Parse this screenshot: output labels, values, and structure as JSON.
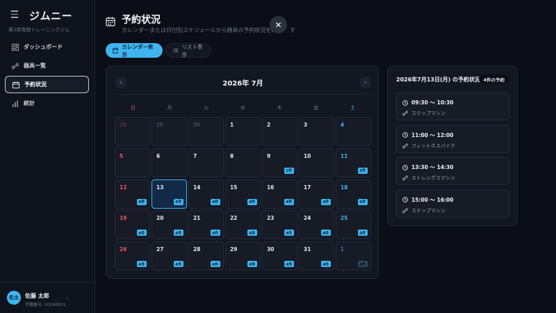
{
  "app": {
    "brand": "ジムニー",
    "subtitle": "第2体育館トレーニングジム"
  },
  "sidebar": {
    "items": [
      {
        "label": "ダッシュボード",
        "icon": "dashboard-icon",
        "active": false
      },
      {
        "label": "器具一覧",
        "icon": "equipment-icon",
        "active": false
      },
      {
        "label": "予約状況",
        "icon": "calendar-icon",
        "active": true
      },
      {
        "label": "統計",
        "icon": "chart-icon",
        "active": false
      }
    ]
  },
  "user": {
    "avatar": "佐太",
    "name": "佐藤 太郎",
    "id": "学籍番号: 20240001"
  },
  "header": {
    "title": "予約状況",
    "subtitle": "カレンダーまたは日付別スケジュールから器具の予約状況を確認 　す"
  },
  "view_toggle": {
    "calendar_label": "カレンダー表示",
    "list_label": "リスト表示"
  },
  "calendar": {
    "month_title": "2026年 7月",
    "weekdays": [
      "日",
      "月",
      "火",
      "水",
      "木",
      "金",
      "土"
    ],
    "weeks": [
      [
        {
          "day": "28",
          "other": true,
          "badge": ""
        },
        {
          "day": "29",
          "other": true,
          "badge": ""
        },
        {
          "day": "30",
          "other": true,
          "badge": ""
        },
        {
          "day": "1",
          "badge": ""
        },
        {
          "day": "2",
          "badge": ""
        },
        {
          "day": "3",
          "badge": ""
        },
        {
          "day": "4",
          "badge": ""
        }
      ],
      [
        {
          "day": "5",
          "badge": ""
        },
        {
          "day": "6",
          "badge": ""
        },
        {
          "day": "7",
          "badge": ""
        },
        {
          "day": "8",
          "badge": ""
        },
        {
          "day": "9",
          "badge": "1件"
        },
        {
          "day": "10",
          "badge": ""
        },
        {
          "day": "11",
          "badge": "3件"
        }
      ],
      [
        {
          "day": "12",
          "badge": "4件"
        },
        {
          "day": "13",
          "badge": "4件",
          "today": true
        },
        {
          "day": "14",
          "badge": "4件"
        },
        {
          "day": "15",
          "badge": "4件"
        },
        {
          "day": "16",
          "badge": "4件"
        },
        {
          "day": "17",
          "badge": "4件"
        },
        {
          "day": "18",
          "badge": "4件"
        }
      ],
      [
        {
          "day": "19",
          "badge": "4件"
        },
        {
          "day": "20",
          "badge": "4件"
        },
        {
          "day": "21",
          "badge": "4件"
        },
        {
          "day": "22",
          "badge": "4件"
        },
        {
          "day": "23",
          "badge": "4件"
        },
        {
          "day": "24",
          "badge": "4件"
        },
        {
          "day": "25",
          "badge": "4件"
        }
      ],
      [
        {
          "day": "26",
          "badge": "4件"
        },
        {
          "day": "27",
          "badge": "4件"
        },
        {
          "day": "28",
          "badge": "4件"
        },
        {
          "day": "29",
          "badge": "4件"
        },
        {
          "day": "30",
          "badge": "4件"
        },
        {
          "day": "31",
          "badge": "4件"
        },
        {
          "day": "1",
          "other": true,
          "badge": "4件"
        }
      ]
    ]
  },
  "reservations": {
    "title": "2026年7月13日(月) の予約状況",
    "count_badge": "4件の予約",
    "items": [
      {
        "time": "09:30 〜 10:30",
        "equipment": "ステップマシン"
      },
      {
        "time": "11:00 〜 12:00",
        "equipment": "フィットネスバイク"
      },
      {
        "time": "13:30 〜 14:30",
        "equipment": "ストレングスマシン"
      },
      {
        "time": "15:00 〜 16:00",
        "equipment": "ステップマシン"
      }
    ]
  },
  "colors": {
    "accent": "#3fb5f0",
    "sunday": "#f0535e",
    "background": "#0b0e16"
  }
}
